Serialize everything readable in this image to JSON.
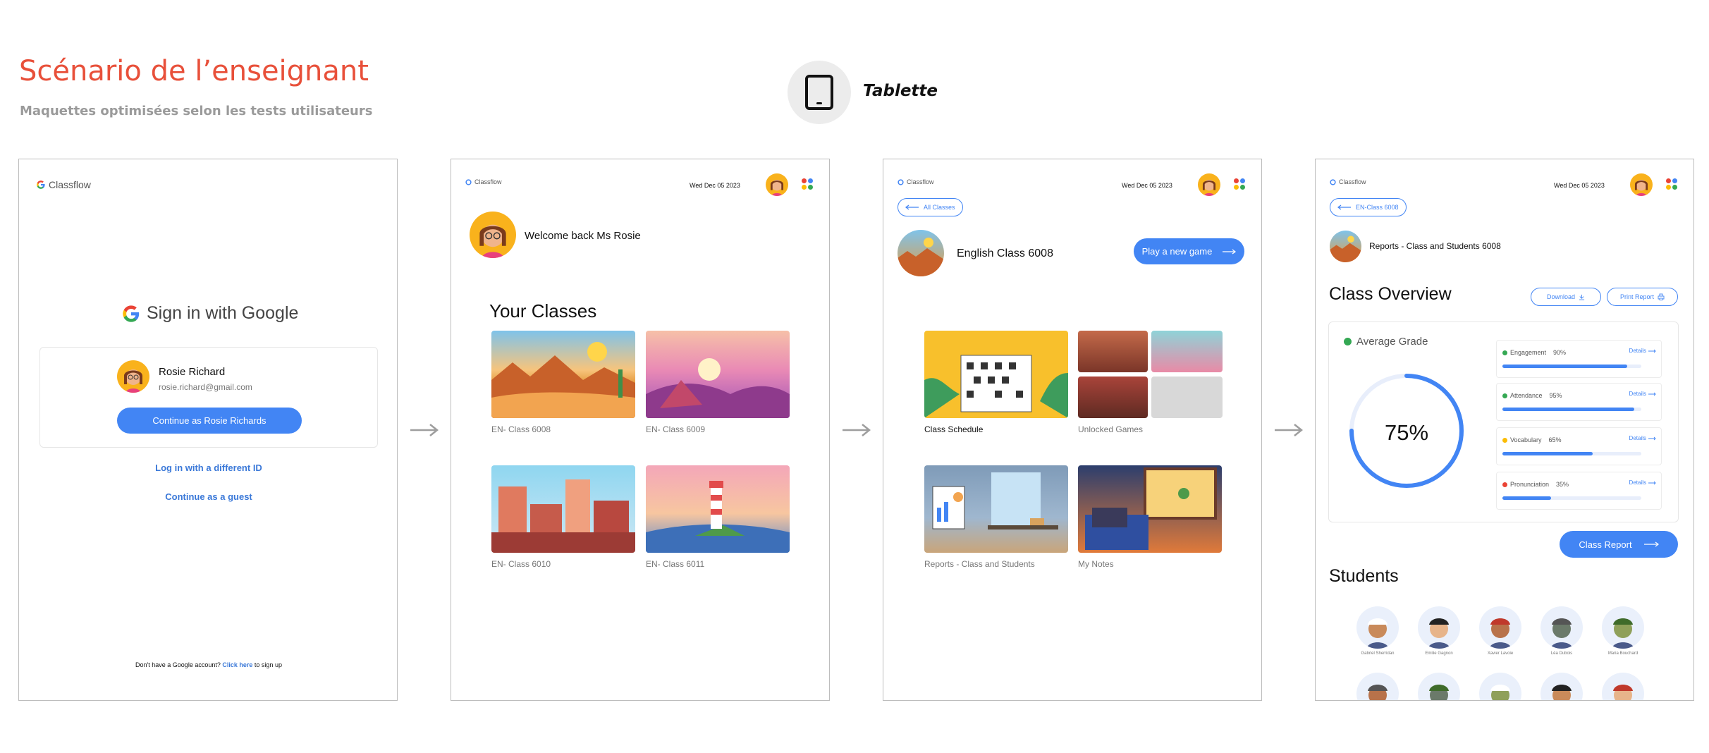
{
  "header": {
    "title": "Scénario de l’enseignant",
    "subtitle": "Maquettes optimisées selon les tests utilisateurs",
    "device_label": "Tablette",
    "device_icon": "tablet-icon"
  },
  "brand": {
    "logo_text": "Classflow",
    "accent": "#4285f4",
    "title_color": "#e8503a"
  },
  "screen_signin": {
    "heading": "Sign in with Google",
    "user_name": "Rosie Richard",
    "user_email": "rosie.richard@gmail.com",
    "continue_label": "Continue as Rosie Richards",
    "different_id_label": "Log in with a different ID",
    "guest_label": "Continue as a guest",
    "footer_text": "Don't have a Google account?",
    "footer_link": "Click here",
    "footer_tail": "to sign up"
  },
  "screen_home": {
    "date": "Wed Dec 05 2023",
    "welcome": "Welcome back Ms Rosie",
    "classes_heading": "Your Classes",
    "classes": [
      {
        "label": "EN- Class 6008"
      },
      {
        "label": "EN- Class 6009"
      },
      {
        "label": "EN- Class 6010"
      },
      {
        "label": "EN- Class 6011"
      }
    ]
  },
  "screen_class": {
    "date": "Wed Dec 05 2023",
    "back_label": "All Classes",
    "class_title": "English Class 6008",
    "play_label": "Play a new game",
    "tiles": [
      {
        "label": "Class Schedule"
      },
      {
        "label": "Unlocked Games"
      },
      {
        "label": "Reports - Class and Students"
      },
      {
        "label": "My Notes"
      }
    ]
  },
  "screen_reports": {
    "date": "Wed Dec 05 2023",
    "back_label": "EN-Class 6008",
    "page_title": "Reports - Class and Students 6008",
    "overview_heading": "Class Overview",
    "download_label": "Download",
    "print_label": "Print Report",
    "average_label": "Average Grade",
    "average_value": "75%",
    "average_fraction": 0.75,
    "details_label": "Details",
    "metrics": [
      {
        "name": "Engagement",
        "value": "90%",
        "fraction": 0.9,
        "color": "#34a853"
      },
      {
        "name": "Attendance",
        "value": "95%",
        "fraction": 0.95,
        "color": "#34a853"
      },
      {
        "name": "Vocabulary",
        "value": "65%",
        "fraction": 0.65,
        "color": "#fbbc05"
      },
      {
        "name": "Pronunciation",
        "value": "35%",
        "fraction": 0.35,
        "color": "#ea4335"
      }
    ],
    "report_label": "Class Report",
    "students_heading": "Students",
    "students": [
      {
        "name": "Gabriel Sherridan"
      },
      {
        "name": "Emilie Gagnon"
      },
      {
        "name": "Xavier Lavoie"
      },
      {
        "name": "Léa Dubois"
      },
      {
        "name": "Maria Bouchard"
      }
    ]
  }
}
